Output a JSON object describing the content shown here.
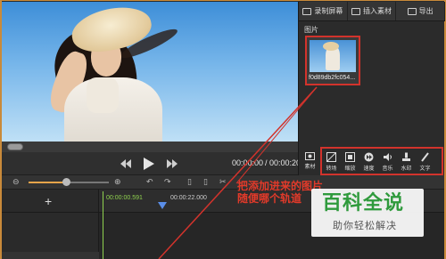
{
  "player": {
    "current_time": "00:00:00",
    "total_time": "00:00:20",
    "separator": "/"
  },
  "tabs": [
    {
      "label": "录制屏幕",
      "icon": "record-screen-icon"
    },
    {
      "label": "插入素材",
      "icon": "insert-media-icon"
    },
    {
      "label": "导出",
      "icon": "export-icon"
    }
  ],
  "media": {
    "section_label": "图片",
    "items": [
      {
        "name": "f0d89db2fc054..."
      }
    ]
  },
  "tools": {
    "material": "素材",
    "items": [
      {
        "label": "转场",
        "icon": "transition-icon"
      },
      {
        "label": "缩放",
        "icon": "zoom-icon"
      },
      {
        "label": "速度",
        "icon": "speed-icon"
      },
      {
        "label": "音乐",
        "icon": "music-icon"
      },
      {
        "label": "水印",
        "icon": "watermark-icon"
      },
      {
        "label": "文字",
        "icon": "text-icon"
      }
    ]
  },
  "timeline": {
    "time_current": "00:00:00.591",
    "time_mark": "00:00:22.000",
    "add_track_label": "+"
  },
  "annotation": {
    "line1": "把添加进来的图片",
    "line2": "随便哪个轨道"
  },
  "watermark": {
    "brand": "百科全说",
    "tagline": "助你轻松解决"
  }
}
